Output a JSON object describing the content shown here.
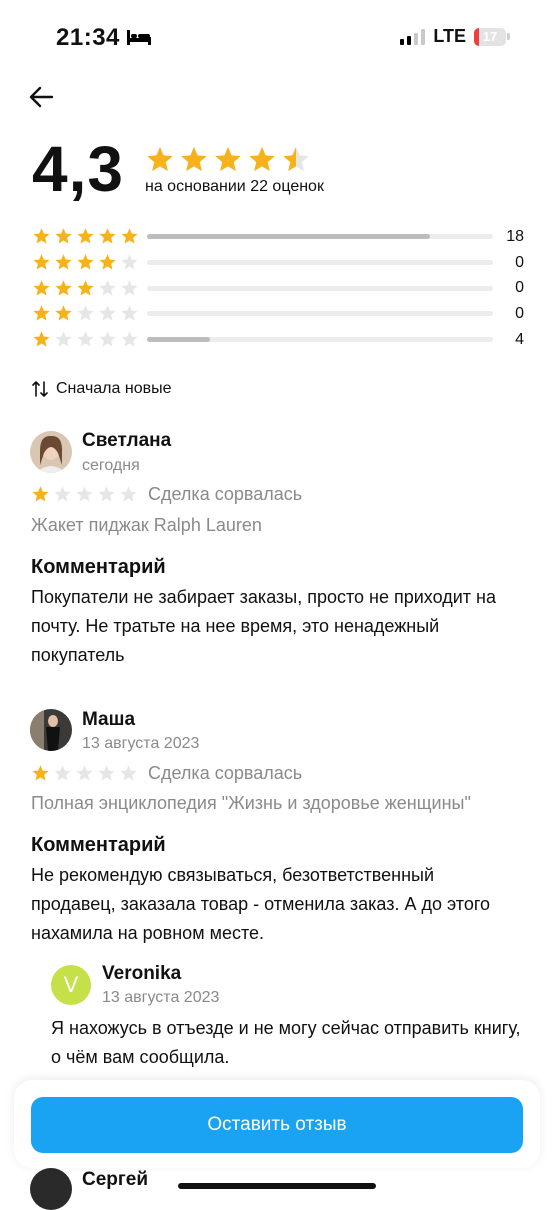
{
  "status": {
    "time": "21:34",
    "network": "LTE",
    "battery": "17"
  },
  "header": {
    "back_icon": "arrow-left-icon"
  },
  "summary": {
    "rating": "4,3",
    "stars_filled": 4.5,
    "based_on": "на основании 22 оценок"
  },
  "histogram": [
    {
      "stars": 5,
      "count": "18",
      "fraction": 0.818
    },
    {
      "stars": 4,
      "count": "0",
      "fraction": 0
    },
    {
      "stars": 3,
      "count": "0",
      "fraction": 0
    },
    {
      "stars": 2,
      "count": "0",
      "fraction": 0
    },
    {
      "stars": 1,
      "count": "4",
      "fraction": 0.182
    }
  ],
  "sort": {
    "label": "Сначала новые",
    "icon": "sort-arrows-icon"
  },
  "reviews": [
    {
      "name": "Светлана",
      "date": "сегодня",
      "stars": 1,
      "outcome": "Сделка сорвалась",
      "product": "Жакет пиджак Ralph Lauren",
      "comment_title": "Комментарий",
      "comment": "Покупатели не забирает заказы, просто не приходит на почту. Не тратьте на нее время, это ненадежный покупатель"
    },
    {
      "name": "Маша",
      "date": "13 августа 2023",
      "stars": 1,
      "outcome": "Сделка сорвалась",
      "product": "Полная энциклопедия \"Жизнь и здоровье женщины\"",
      "comment_title": "Комментарий",
      "comment": "Не рекомендую связываться, безответственный продавец, заказала товар - отменила заказ. А до этого нахамила на ровном месте.",
      "reply": {
        "initial": "V",
        "name": "Veronika",
        "date": "13 августа 2023",
        "text": "Я нахожусь в отъезде и не могу сейчас отправить книгу, о чём вам сообщила."
      }
    },
    {
      "name": "Сергей"
    }
  ],
  "cta": {
    "label": "Оставить отзыв"
  },
  "colors": {
    "star": "#f7b21b",
    "star_empty": "#e6e6e6",
    "accent": "#1aa3f2",
    "reply_avatar": "#c6e04a"
  }
}
